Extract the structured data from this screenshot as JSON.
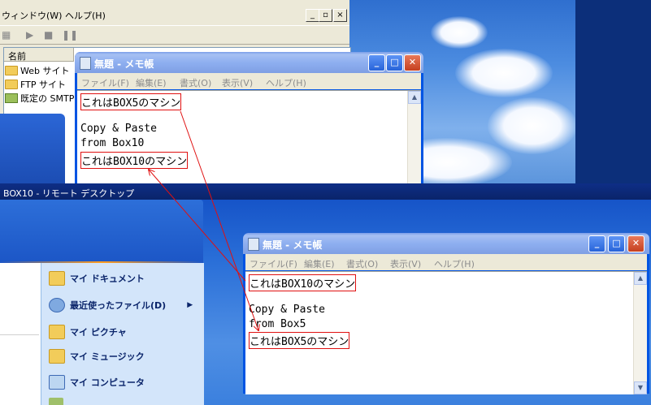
{
  "top_window": {
    "menu": [
      {
        "label": "ウィンドウ(W)"
      },
      {
        "label": "ヘルプ(H)"
      }
    ],
    "list_header": "名前",
    "list_items": [
      {
        "label": "Web サイト",
        "icon": "folder-icon"
      },
      {
        "label": "FTP サイト",
        "icon": "folder-icon"
      },
      {
        "label": "既定の SMTP",
        "icon": "smtp-icon"
      }
    ],
    "toolbar_icons": [
      "tb-icon",
      "play-icon",
      "stop-icon",
      "pause-icon"
    ],
    "window_controls": {
      "minimize": "_",
      "restore": "▫",
      "close": "×"
    }
  },
  "notepad_box5": {
    "title": "無題 - メモ帳",
    "menu": [
      "ファイル(F)",
      "編集(E)",
      "書式(O)",
      "表示(V)",
      "ヘルプ(H)"
    ],
    "lines": [
      "これはBOX5のマシン",
      "",
      "Copy & Paste",
      "from Box10",
      "これはBOX10のマシン"
    ]
  },
  "remote_bar": {
    "title": "BOX10 - リモート デスクトップ"
  },
  "start_menu": {
    "items": [
      {
        "label": "マイ ドキュメント",
        "icon": "folder-icon"
      },
      {
        "label": "最近使ったファイル(D)",
        "icon": "recent-icon",
        "arrow": "▶"
      },
      {
        "label": "マイ ピクチャ",
        "icon": "folder-icon"
      },
      {
        "label": "マイ ミュージック",
        "icon": "folder-icon"
      },
      {
        "label": "マイ コンピュータ",
        "icon": "computer-icon"
      }
    ]
  },
  "notepad_box10": {
    "title": "無題 - メモ帳",
    "menu": [
      "ファイル(F)",
      "編集(E)",
      "書式(O)",
      "表示(V)",
      "ヘルプ(H)"
    ],
    "lines": [
      "これはBOX10のマシン",
      "",
      "Copy & Paste",
      "from Box5",
      "これはBOX5のマシン"
    ]
  },
  "colors": {
    "xp_title_blue": "#0a58dc",
    "highlight_red": "#e01010",
    "remote_bar": "#0a246a",
    "window_face": "#ece9d8"
  }
}
